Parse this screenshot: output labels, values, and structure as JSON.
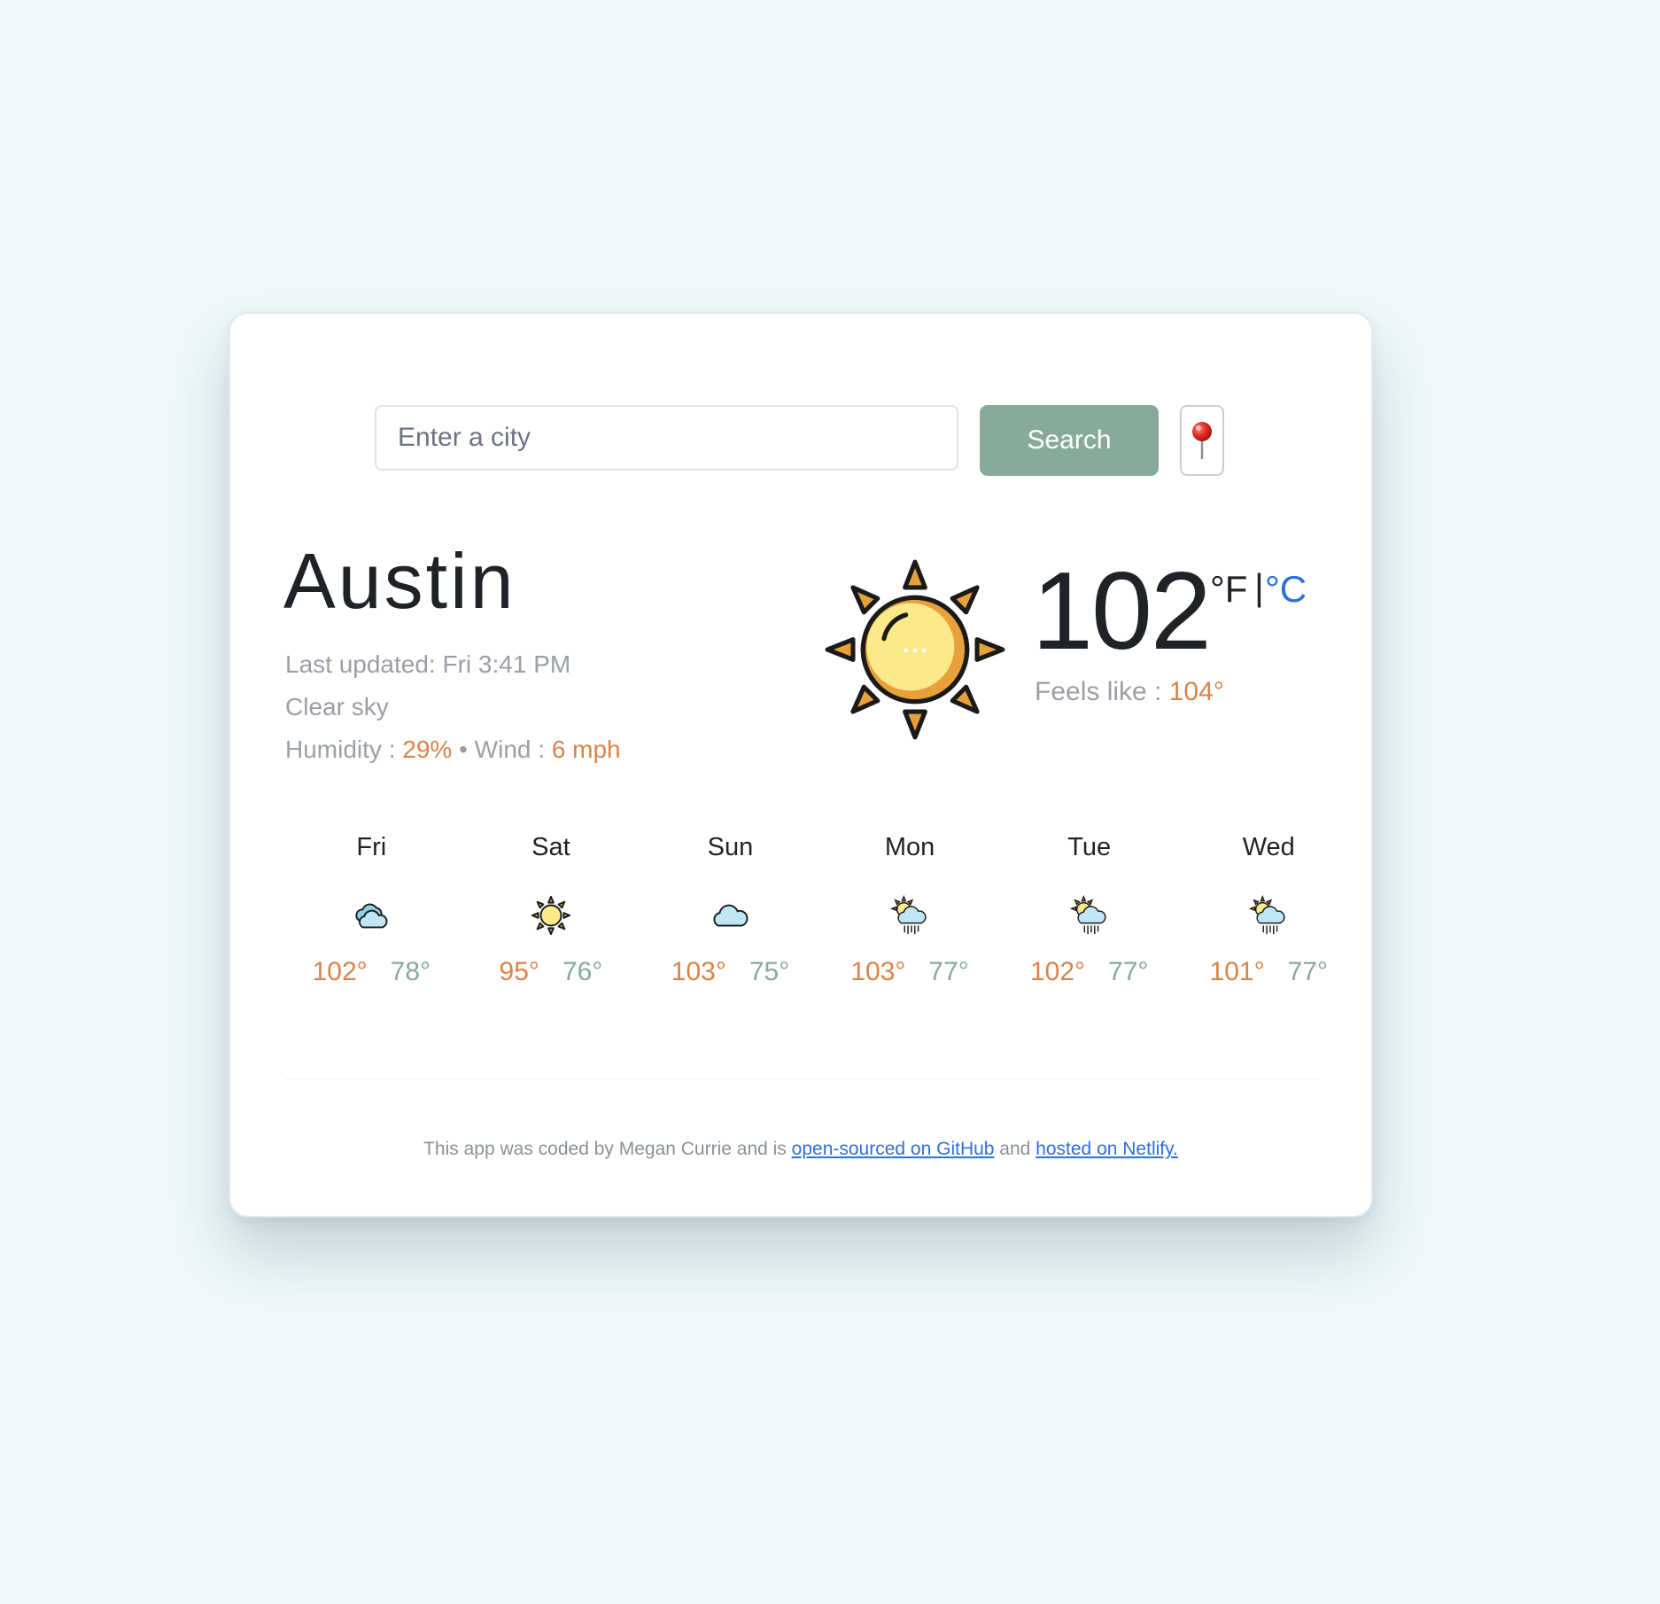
{
  "search": {
    "placeholder": "Enter a city",
    "button_label": "Search"
  },
  "current": {
    "city": "Austin",
    "last_updated_label": "Last updated:",
    "last_updated": "Fri 3:41 PM",
    "description": "Clear sky",
    "humidity_label": "Humidity :",
    "humidity": "29%",
    "separator": "•",
    "wind_label": "Wind :",
    "wind": "6 mph",
    "temperature": "102",
    "unit_f": "°F",
    "unit_separator": "|",
    "unit_c": "°C",
    "feels_like_label": "Feels like :",
    "feels_like": "104°",
    "icon": "clear-sky-sun-icon"
  },
  "forecast": [
    {
      "day": "Fri",
      "icon": "cloudy-icon",
      "max": "102°",
      "min": "78°"
    },
    {
      "day": "Sat",
      "icon": "sun-icon",
      "max": "95°",
      "min": "76°"
    },
    {
      "day": "Sun",
      "icon": "cloud-icon",
      "max": "103°",
      "min": "75°"
    },
    {
      "day": "Mon",
      "icon": "sun-rain-cloud-icon",
      "max": "103°",
      "min": "77°"
    },
    {
      "day": "Tue",
      "icon": "sun-rain-cloud-icon",
      "max": "102°",
      "min": "77°"
    },
    {
      "day": "Wed",
      "icon": "sun-rain-cloud-icon",
      "max": "101°",
      "min": "77°"
    }
  ],
  "footer": {
    "text_before": "This app was coded by Megan Currie and is ",
    "github_link": "open-sourced on GitHub",
    "text_middle": " and ",
    "netlify_link": "hosted on Netlify."
  },
  "colors": {
    "accent": "#d9834a",
    "button": "#88aa99",
    "link": "#2f6fd8",
    "background": "#eff9fb"
  }
}
